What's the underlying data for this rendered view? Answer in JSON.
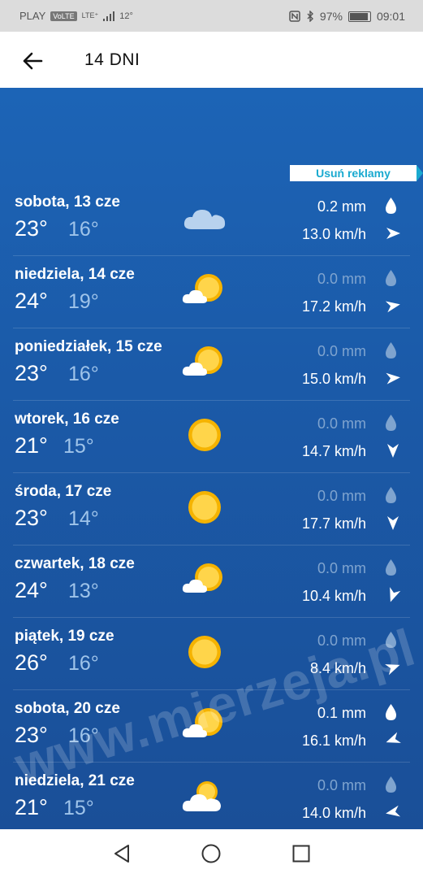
{
  "status_bar": {
    "carrier": "PLAY",
    "volte": "VoLTE",
    "network": "LTE⁺",
    "temp": "12°",
    "battery": "97%",
    "time": "09:01"
  },
  "app_bar": {
    "title": "14 DNI"
  },
  "ad_badge": {
    "label": "Usuń reklamy"
  },
  "days": [
    {
      "day": "sobota, 13 cze",
      "tmax": "23°",
      "tmin": "16°",
      "icon": "cloudy-icon",
      "rain": "0.2 mm",
      "rain_active": true,
      "wind": "13.0 km/h",
      "wind_dir_deg": 90
    },
    {
      "day": "niedziela, 14 cze",
      "tmax": "24°",
      "tmin": "19°",
      "icon": "partly-sunny-icon",
      "rain": "0.0 mm",
      "rain_active": false,
      "wind": "17.2 km/h",
      "wind_dir_deg": 80
    },
    {
      "day": "poniedziałek, 15 cze",
      "tmax": "23°",
      "tmin": "16°",
      "icon": "partly-sunny-icon",
      "rain": "0.0 mm",
      "rain_active": false,
      "wind": "15.0 km/h",
      "wind_dir_deg": 85
    },
    {
      "day": "wtorek, 16 cze",
      "tmax": "21°",
      "tmin": "15°",
      "icon": "sunny-icon",
      "rain": "0.0 mm",
      "rain_active": false,
      "wind": "14.7 km/h",
      "wind_dir_deg": 180
    },
    {
      "day": "środa, 17 cze",
      "tmax": "23°",
      "tmin": "14°",
      "icon": "sunny-icon",
      "rain": "0.0 mm",
      "rain_active": false,
      "wind": "17.7 km/h",
      "wind_dir_deg": 180
    },
    {
      "day": "czwartek, 18 cze",
      "tmax": "24°",
      "tmin": "13°",
      "icon": "partly-sunny-icon",
      "rain": "0.0 mm",
      "rain_active": false,
      "wind": "10.4 km/h",
      "wind_dir_deg": 200
    },
    {
      "day": "piątek, 19 cze",
      "tmax": "26°",
      "tmin": "16°",
      "icon": "sunny-icon",
      "rain": "0.0 mm",
      "rain_active": false,
      "wind": "8.4 km/h",
      "wind_dir_deg": 70
    },
    {
      "day": "sobota, 20 cze",
      "tmax": "23°",
      "tmin": "16°",
      "icon": "partly-sunny-icon",
      "rain": "0.1 mm",
      "rain_active": true,
      "wind": "16.1 km/h",
      "wind_dir_deg": 250
    },
    {
      "day": "niedziela, 21 cze",
      "tmax": "21°",
      "tmin": "15°",
      "icon": "partly-cloudy-icon",
      "rain": "0.0 mm",
      "rain_active": false,
      "wind": "14.0 km/h",
      "wind_dir_deg": 260
    }
  ],
  "watermark": "www.mierzeja.pl"
}
